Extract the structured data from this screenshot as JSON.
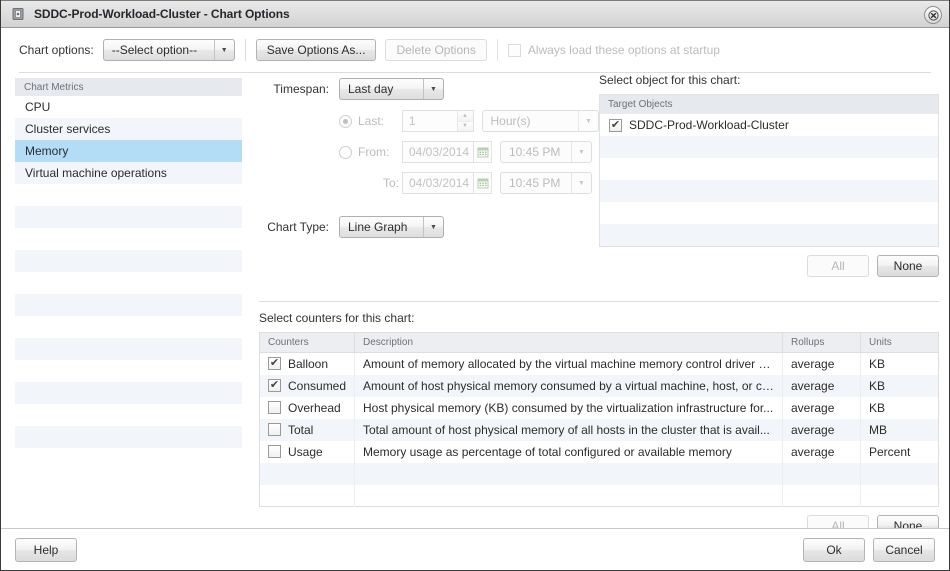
{
  "window": {
    "title": "SDDC-Prod-Workload-Cluster - Chart Options",
    "icon": "chart-window-icon",
    "close_label": "✕"
  },
  "toolbar": {
    "chart_options_label": "Chart options:",
    "chart_options_select": {
      "value": "--Select option--",
      "arrow": "▼"
    },
    "save_options_label": "Save Options As...",
    "delete_options_label": "Delete Options",
    "always_load_label": "Always load these options at startup",
    "always_load_checked": false
  },
  "sidebar": {
    "header": "Chart Metrics",
    "items": [
      {
        "label": "CPU",
        "selected": false
      },
      {
        "label": "Cluster services",
        "selected": false
      },
      {
        "label": "Memory",
        "selected": true
      },
      {
        "label": "Virtual machine operations",
        "selected": false
      }
    ],
    "empty_row_count": 13
  },
  "timespan": {
    "label": "Timespan:",
    "select": {
      "value": "Last day",
      "arrow": "▼"
    },
    "last": {
      "radio_label": "Last:",
      "selected": true,
      "amount": "1",
      "unit": "Hour(s)",
      "unit_arrow": "▼"
    },
    "from": {
      "radio_label": "From:",
      "selected": false,
      "date": "04/03/2014",
      "time": "10:45 PM",
      "time_arrow": "▼"
    },
    "to": {
      "label": "To:",
      "date": "04/03/2014",
      "time": "10:45 PM",
      "time_arrow": "▼"
    }
  },
  "chart_type": {
    "label": "Chart Type:",
    "select": {
      "value": "Line Graph",
      "arrow": "▼"
    }
  },
  "target_objects": {
    "pane_label": "Select object for this chart:",
    "column_header": "Target Objects",
    "rows": [
      {
        "label": "SDDC-Prod-Workload-Cluster",
        "checked": true
      }
    ],
    "empty_row_count": 5,
    "all_label": "All",
    "all_disabled": true,
    "none_label": "None",
    "none_disabled": false
  },
  "counters": {
    "pane_label": "Select counters for this chart:",
    "columns": [
      "Counters",
      "Description",
      "Rollups",
      "Units"
    ],
    "rows": [
      {
        "name": "Balloon",
        "checked": true,
        "description": "Amount of memory allocated by the virtual machine memory control driver (v...",
        "rollups": "average",
        "units": "KB"
      },
      {
        "name": "Consumed",
        "checked": true,
        "description": "Amount of host physical memory consumed by a virtual machine, host, or cl...",
        "rollups": "average",
        "units": "KB"
      },
      {
        "name": "Overhead",
        "checked": false,
        "description": "Host physical memory (KB) consumed by the virtualization infrastructure for...",
        "rollups": "average",
        "units": "KB"
      },
      {
        "name": "Total",
        "checked": false,
        "description": "Total amount of host physical memory of all hosts in the cluster that is avail...",
        "rollups": "average",
        "units": "MB"
      },
      {
        "name": "Usage",
        "checked": false,
        "description": "Memory usage as percentage of total configured or available memory",
        "rollups": "average",
        "units": "Percent"
      }
    ],
    "empty_row_count": 2,
    "all_label": "All",
    "all_disabled": true,
    "none_label": "None",
    "none_disabled": false
  },
  "footer": {
    "help_label": "Help",
    "ok_label": "Ok",
    "cancel_label": "Cancel"
  },
  "colors": {
    "selection": "#b3dcf7",
    "row_alt": "#f2f5f9",
    "header_bg": "#e6e9ed",
    "disabled_text": "#bcbcbc"
  }
}
